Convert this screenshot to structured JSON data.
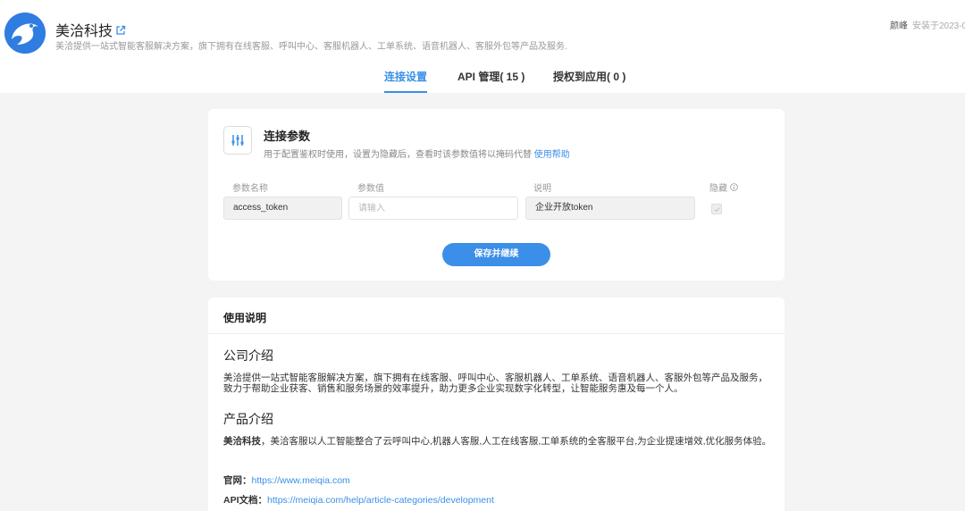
{
  "header": {
    "app_name": "美洽科技",
    "app_desc": "美洽提供一站式智能客服解决方案，旗下拥有在线客服、呼叫中心、客服机器人、工单系统、语音机器人、客服外包等产品及服务.",
    "author": "颜峰",
    "installed": "安装于2023-0",
    "brand_color": "#2f7de1"
  },
  "tabs": [
    {
      "label": "连接设置",
      "active": true
    },
    {
      "label": "API 管理( 15 )",
      "active": false
    },
    {
      "label": "授权到应用( 0 )",
      "active": false
    }
  ],
  "params_card": {
    "title": "连接参数",
    "subtitle": "用于配置鉴权时使用，设置为隐藏后，查看时该参数值将以掩码代替",
    "help_link": "使用帮助",
    "columns": {
      "name": "参数名称",
      "value": "参数值",
      "desc": "说明",
      "hidden": "隐藏"
    },
    "row": {
      "name": "access_token",
      "value": "",
      "value_placeholder": "请输入",
      "desc": "企业开放token",
      "hidden": true
    },
    "save_label": "保存并继续",
    "accent": "#3b8fe8"
  },
  "usage": {
    "title": "使用说明",
    "company_title": "公司介绍",
    "company_text": "美洽提供一站式智能客服解决方案，旗下拥有在线客服、呼叫中心、客服机器人、工单系统、语音机器人、客服外包等产品及服务，致力于帮助企业获客、销售和服务场景的效率提升，助力更多企业实现数字化转型，让智能服务惠及每一个人。",
    "product_title": "产品介绍",
    "product_name": "美洽科技",
    "product_text": "，美洽客服以人工智能整合了云呼叫中心,机器人客服,人工在线客服,工单系统的全客服平台,为企业提速增效,优化服务体验。",
    "site_label": "官网：",
    "site_url": "https://www.meiqia.com",
    "api_label": "API文档：",
    "api_url": "https://meiqia.com/help/article-categories/development"
  }
}
